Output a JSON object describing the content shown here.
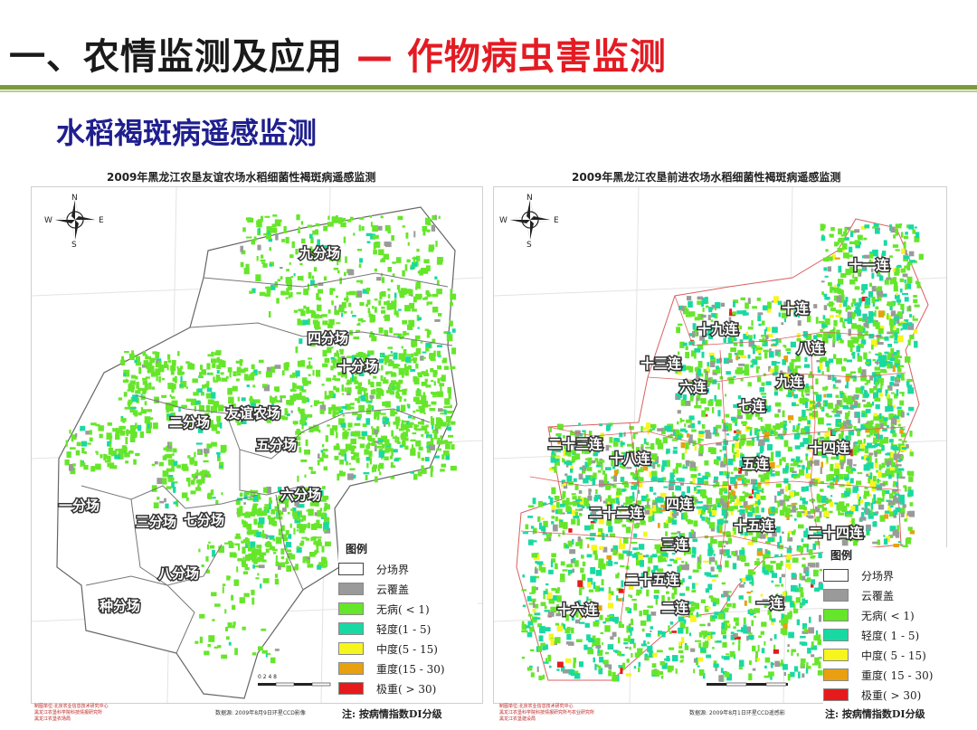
{
  "header": {
    "title_main": "一、农情监测及应用 ",
    "title_sub": "— 作物病虫害监测"
  },
  "section_title": "水稻褐斑病遥感监测",
  "colors": {
    "none": "#66e62a",
    "light": "#19d9a3",
    "moderate": "#f7f51e",
    "heavy": "#e8a010",
    "severe": "#e61a1a",
    "cloud": "#9a9a9a",
    "boundary": "#ffffff"
  },
  "maps": [
    {
      "title": "2009年黑龙江农垦友谊农场水稻细菌性褐斑病遥感监测",
      "compass": {
        "n": "N",
        "s": "S",
        "e": "E",
        "w": "W",
        "icon": "compass-rose-icon"
      },
      "regions": [
        "九分场",
        "四分场",
        "十分场",
        "二分场",
        "友谊农场",
        "五分场",
        "六分场",
        "一分场",
        "三分场",
        "七分场",
        "八分场",
        "种分场"
      ],
      "legend": {
        "title": "图例",
        "items": [
          "分场界",
          "云覆盖",
          "无病( < 1)",
          "轻度(1 - 5)",
          "中度(5 - 15)",
          "重度(15 - 30)",
          "极重( > 30)"
        ],
        "note": "注: 按病情指数DI分级"
      },
      "data_source": "数据源: 2009年8月9日环星CCD影像",
      "credit": [
        "制图单位:北京农业信息技术研究中心",
        "黑龙江农垦科学院科技情报研究所",
        "黑龙江农垦农场局"
      ],
      "scale": "0  2  4  8"
    },
    {
      "title": "2009年黑龙江农垦前进农场水稻细菌性褐斑病遥感监测",
      "compass": {
        "n": "N",
        "s": "S",
        "e": "E",
        "w": "W",
        "icon": "compass-rose-icon"
      },
      "regions": [
        "十一连",
        "十连",
        "十九连",
        "八连",
        "十三连",
        "六连",
        "九连",
        "七连",
        "二十三连",
        "十八连",
        "十四连",
        "五连",
        "四连",
        "二十二连",
        "十五连",
        "二十四连",
        "三连",
        "二十五连",
        "十六连",
        "二连",
        "一连"
      ],
      "legend": {
        "title": "图例",
        "items": [
          "分场界",
          "云覆盖",
          "无病( < 1)",
          "轻度( 1 - 5)",
          "中度( 5 - 15)",
          "重度( 15 - 30)",
          "极重( > 30)"
        ],
        "note": "注: 按病情指数DI分级"
      },
      "data_source": "数据源: 2009年8月1日环星CCD遥感影",
      "credit": [
        "制图单位:北京农业信息技术研究中心",
        "黑龙江农垦科学院科技情报研究所与农业研究所",
        "黑龙江农垦建设局"
      ],
      "scale": ""
    }
  ]
}
